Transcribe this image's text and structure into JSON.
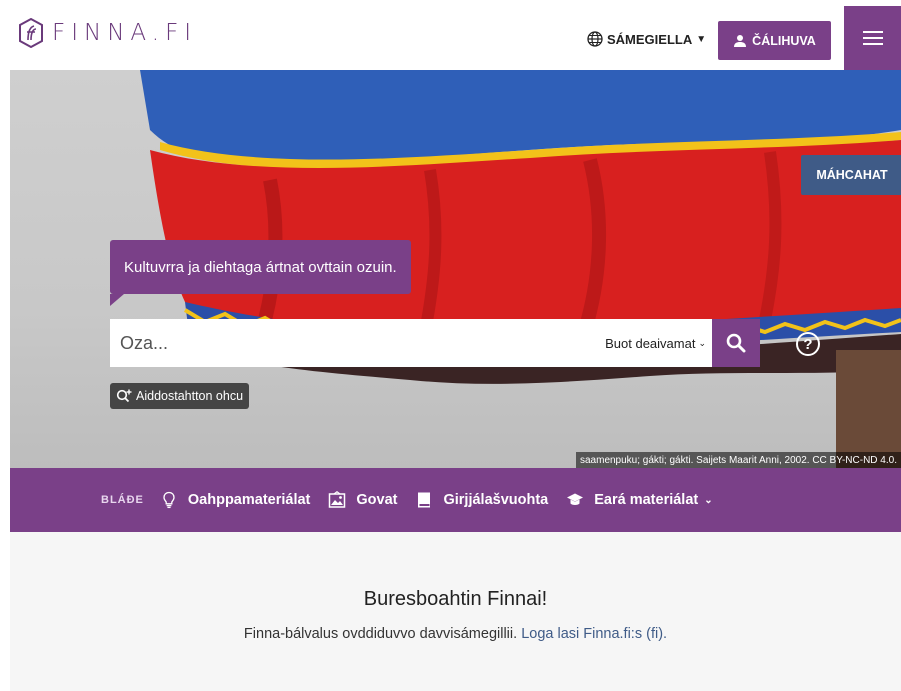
{
  "header": {
    "logo_text": "FINNA.FI",
    "language_label": "SÁMEGIELLA",
    "login_label": "ČÁLIHUVA",
    "menu_icon": "hamburger-icon"
  },
  "hero": {
    "masters_label": "MÁHCAHAT",
    "tagline": "Kultuvrra ja diehtaga ártnat ovttain ozuin.",
    "search": {
      "placeholder": "Oza...",
      "type_selected": "Buot deaivamat"
    },
    "advanced_search_label": "Aiddostahtton ohcu",
    "image_credit": "saamenpuku; gákti; gákti. Saijets Maarit Anni, 2002. CC BY-NC-ND 4.0."
  },
  "browse": {
    "label": "BLÁĐE",
    "items": [
      {
        "label": "Oahppamateriálat",
        "icon": "lightbulb-icon"
      },
      {
        "label": "Govat",
        "icon": "image-icon"
      },
      {
        "label": "Girjjálašvuohta",
        "icon": "book-icon"
      },
      {
        "label": "Eará materiálat",
        "icon": "graduation-cap-icon"
      }
    ]
  },
  "welcome": {
    "title": "Buresboahtin Finnai!",
    "text": "Finna-bálvalus ovddiduvvo davvisámegillii.",
    "link": "Loga lasi Finna.fi:s (fi)."
  },
  "colors": {
    "brand_purple": "#7a4088",
    "masters_blue": "#3f5b87",
    "link_blue": "#3f5b87"
  }
}
